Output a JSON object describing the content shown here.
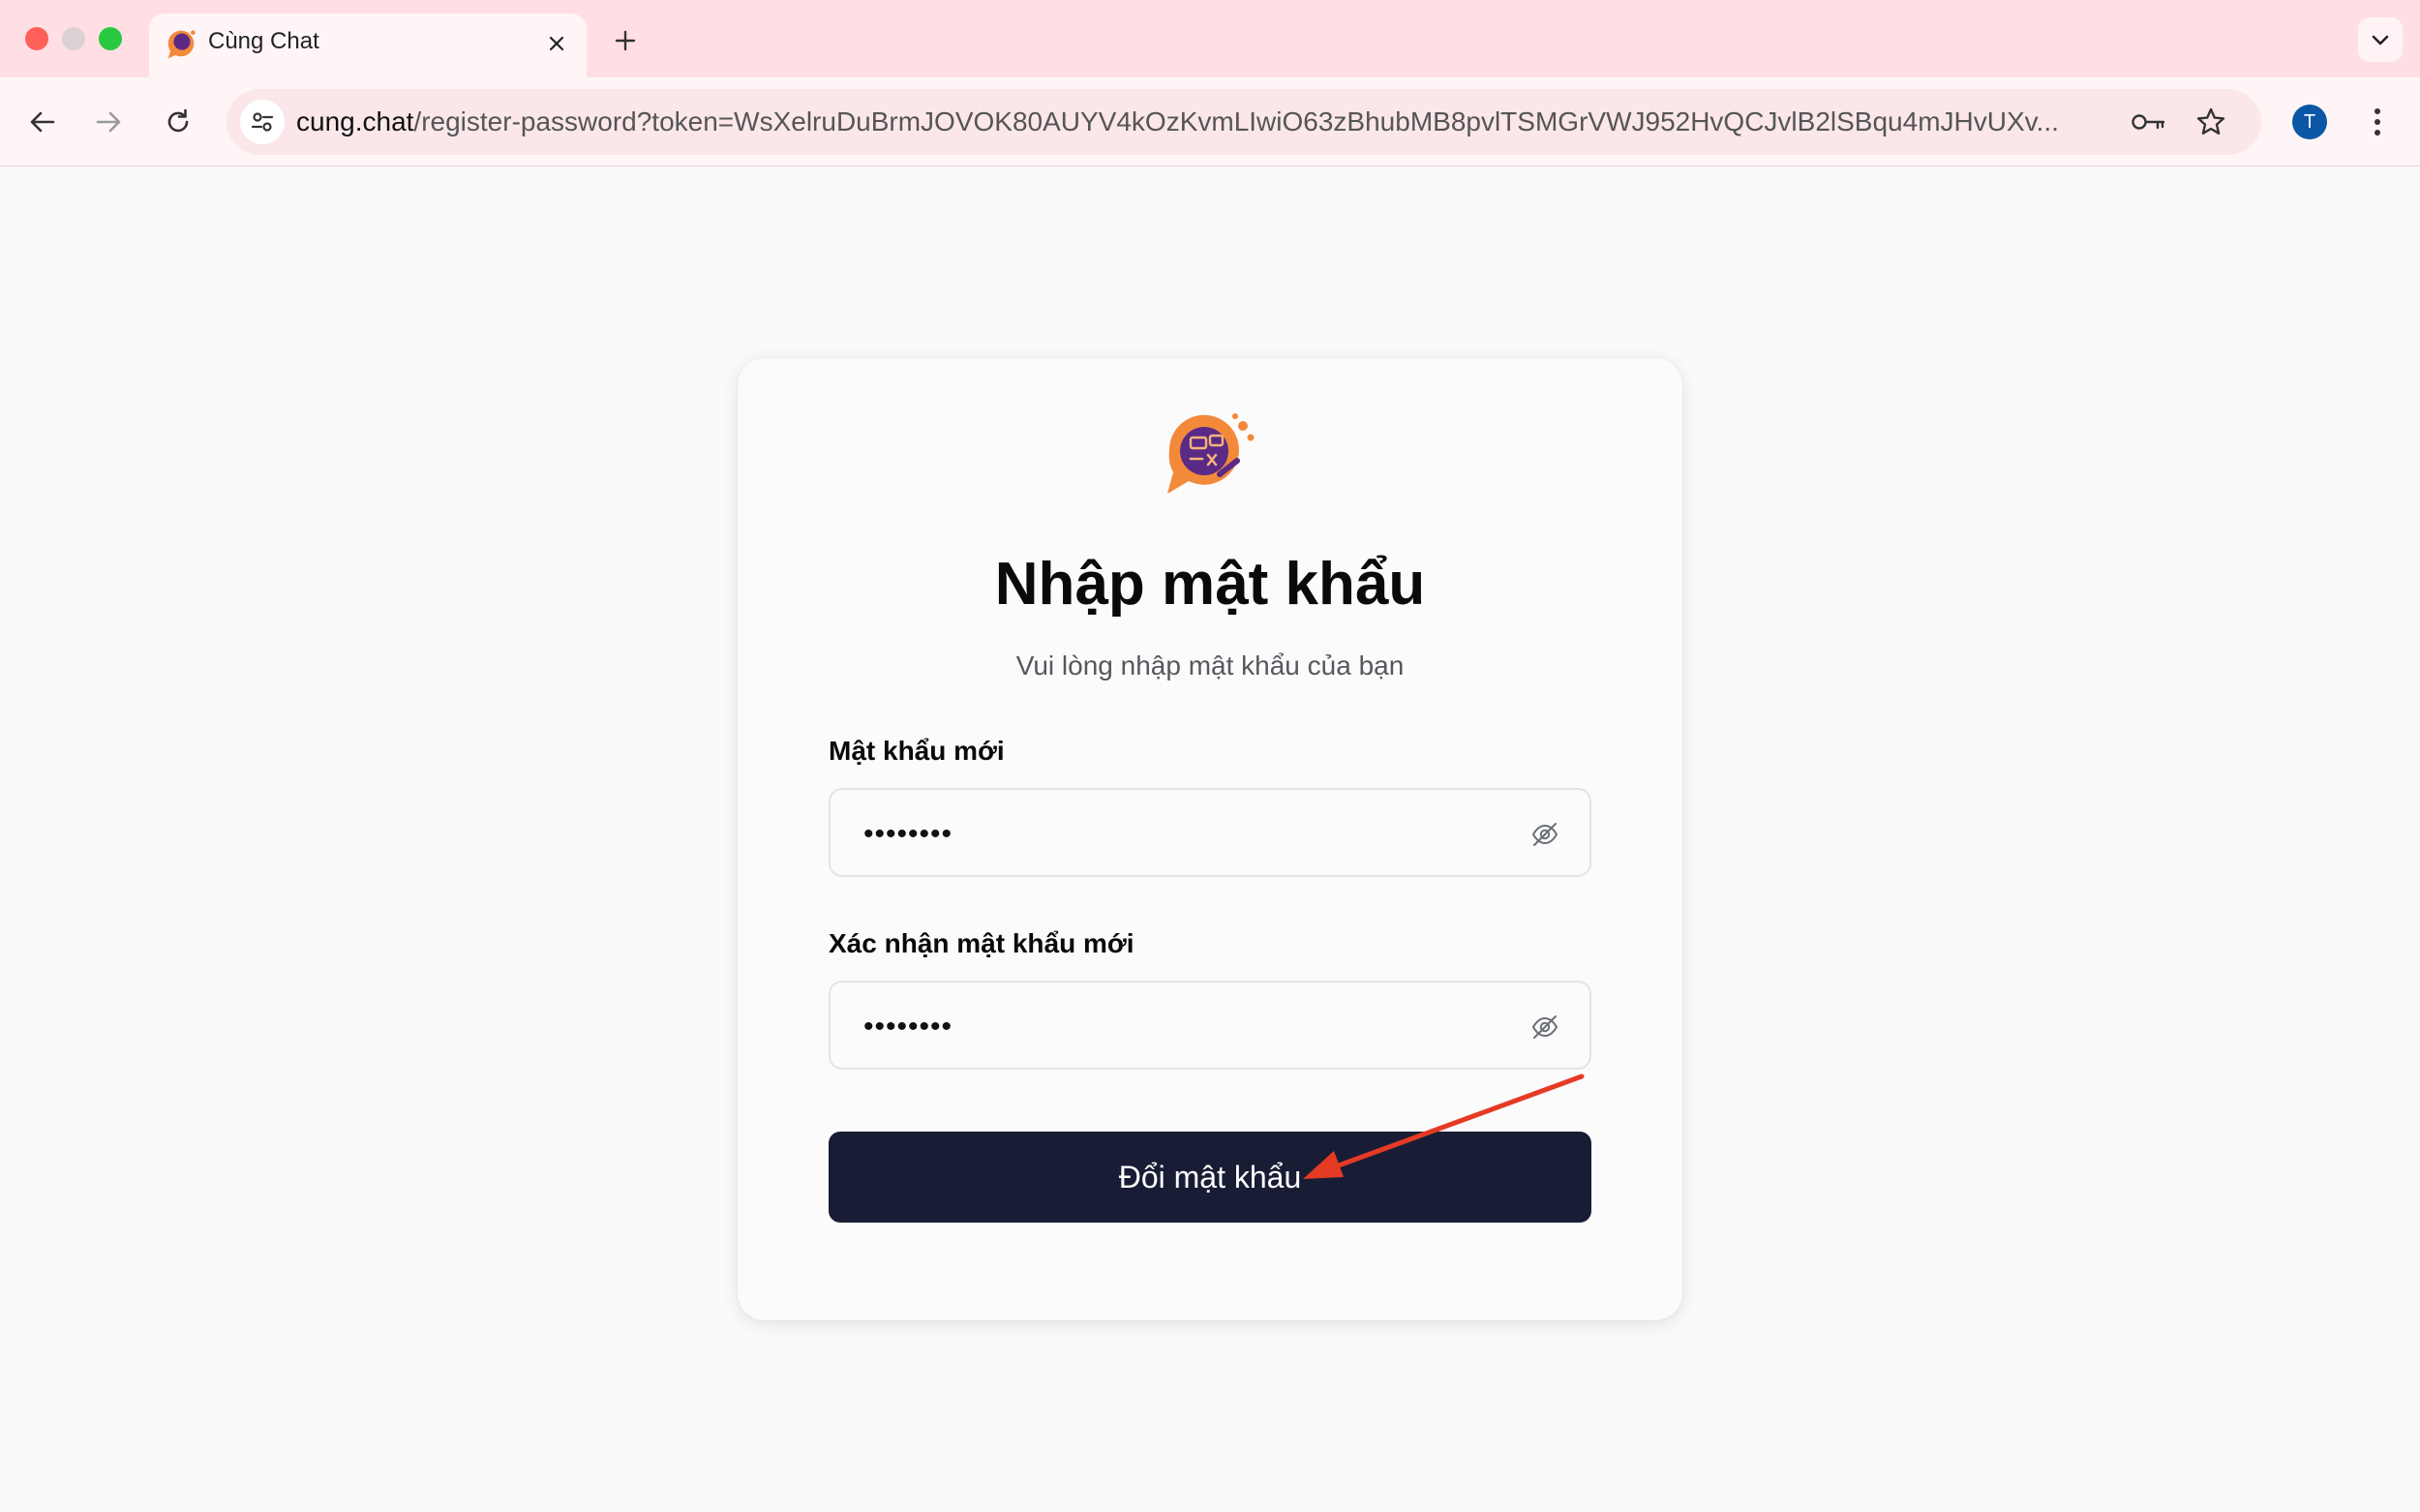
{
  "browser": {
    "tab_title": "Cùng Chat",
    "url_host": "cung.chat",
    "url_rest": "/register-password?token=WsXelruDuBrmJOVOK80AUYV4kOzKvmLIwiO63zBhubMB8pvlTSMGrVWJ952HvQCJvlB2lSBqu4mJHvUXv...",
    "profile_initial": "T"
  },
  "card": {
    "heading": "Nhập mật khẩu",
    "subheading": "Vui lòng nhập mật khẩu của bạn",
    "new_password_label": "Mật khẩu mới",
    "new_password_value": "••••••••",
    "confirm_password_label": "Xác nhận mật khẩu mới",
    "confirm_password_value": "••••••••",
    "submit_label": "Đổi mật khẩu"
  },
  "colors": {
    "titlebar": "#ffdfe4",
    "button": "#181d35",
    "annotation": "#e53a24",
    "logo_orange": "#f28a3a",
    "logo_purple": "#5b2a86"
  },
  "icons": [
    "back-arrow-icon",
    "forward-arrow-icon",
    "reload-icon",
    "site-info-icon",
    "key-icon",
    "star-icon",
    "kebab-menu-icon",
    "close-icon",
    "plus-icon",
    "chevron-down-icon",
    "eye-off-icon"
  ]
}
